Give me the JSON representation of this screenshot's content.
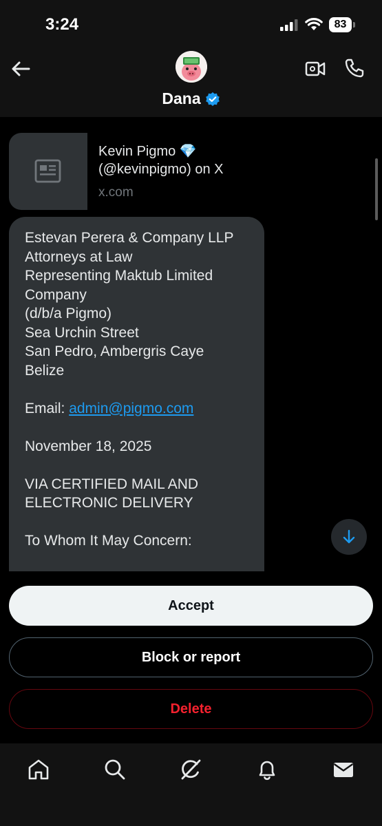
{
  "status_bar": {
    "time": "3:24",
    "battery": "83"
  },
  "header": {
    "contact_name": "Dana",
    "back_icon": "arrow-left-icon",
    "video_icon": "video-camera-icon",
    "phone_icon": "phone-icon"
  },
  "link_preview": {
    "title": "Kevin Pigmo",
    "title_emoji": "💎",
    "handle_line": "(@kevinpigmo) on X",
    "domain": "x.com"
  },
  "message": {
    "lines": [
      "Estevan Perera & Company LLP",
      "Attorneys at Law",
      "Representing Maktub Limited",
      "Company",
      "(d/b/a Pigmo)",
      "Sea Urchin Street",
      "San Pedro, Ambergris Caye",
      "Belize"
    ],
    "email_label": "Email: ",
    "email": "admin@pigmo.com",
    "date": "November 18, 2025",
    "delivery_line1": "VIA CERTIFIED MAIL AND",
    "delivery_line2": "ELECTRONIC DELIVERY",
    "salutation": "To Whom It May Concern:"
  },
  "actions": {
    "accept": "Accept",
    "block_report": "Block or report",
    "delete": "Delete"
  },
  "colors": {
    "accent": "#1d9bf0",
    "danger": "#f4212e",
    "bubble": "#2f3336"
  },
  "nav": {
    "items": [
      "home-icon",
      "search-icon",
      "grok-icon",
      "notifications-icon",
      "messages-icon"
    ]
  }
}
